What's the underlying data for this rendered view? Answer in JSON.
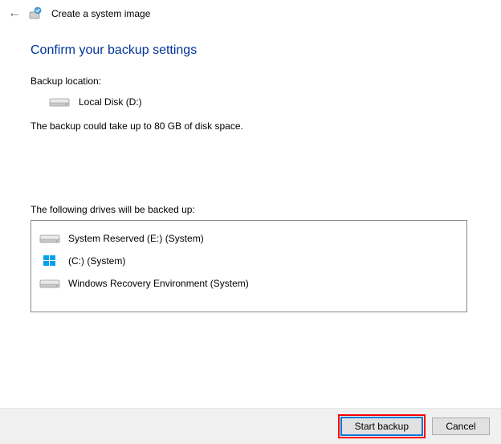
{
  "header": {
    "title": "Create a system image"
  },
  "page": {
    "heading": "Confirm your backup settings",
    "location_label": "Backup location:",
    "location_value": "Local Disk (D:)",
    "size_info": "The backup could take up to 80 GB of disk space.",
    "drives_label": "The following drives will be backed up:",
    "drives": [
      {
        "icon": "hdd",
        "name": "System Reserved (E:) (System)"
      },
      {
        "icon": "windows",
        "name": "(C:) (System)"
      },
      {
        "icon": "hdd",
        "name": "Windows Recovery Environment (System)"
      }
    ]
  },
  "footer": {
    "primary_label": "Start backup",
    "cancel_label": "Cancel"
  }
}
